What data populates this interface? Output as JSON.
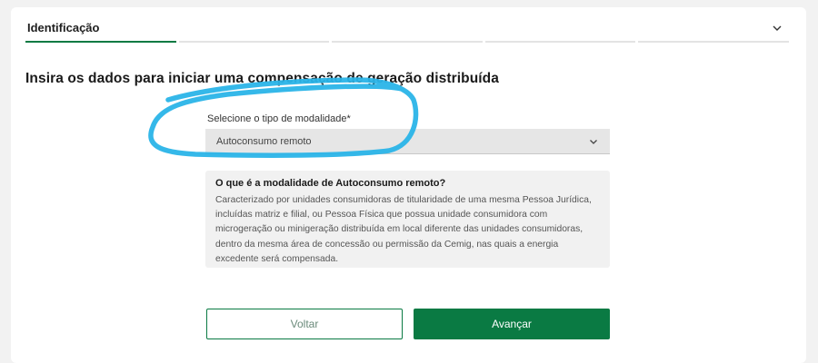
{
  "stepper": {
    "current_step_title": "Identificação",
    "chevron_icon": "chevron-down-icon",
    "accent_color": "#0a7a43"
  },
  "form": {
    "title": "Insira os dados para iniciar uma compensação de geração distribuída",
    "modalidade_label": "Selecione o tipo de modalidade*",
    "modalidade_value": "Autoconsumo remoto"
  },
  "info": {
    "title": "O que é a modalidade de Autoconsumo remoto?",
    "text": "Caracterizado por unidades consumidoras de titularidade de uma mesma Pessoa Jurídica, incluídas matriz e filial, ou Pessoa Física que possua unidade consumidora com microgeração ou minigeração distribuída em local diferente das unidades consumidoras, dentro da mesma área de concessão ou permissão da Cemig, nas quais a energia excedente será compensada."
  },
  "buttons": {
    "back_label": "Voltar",
    "next_label": "Avançar"
  }
}
